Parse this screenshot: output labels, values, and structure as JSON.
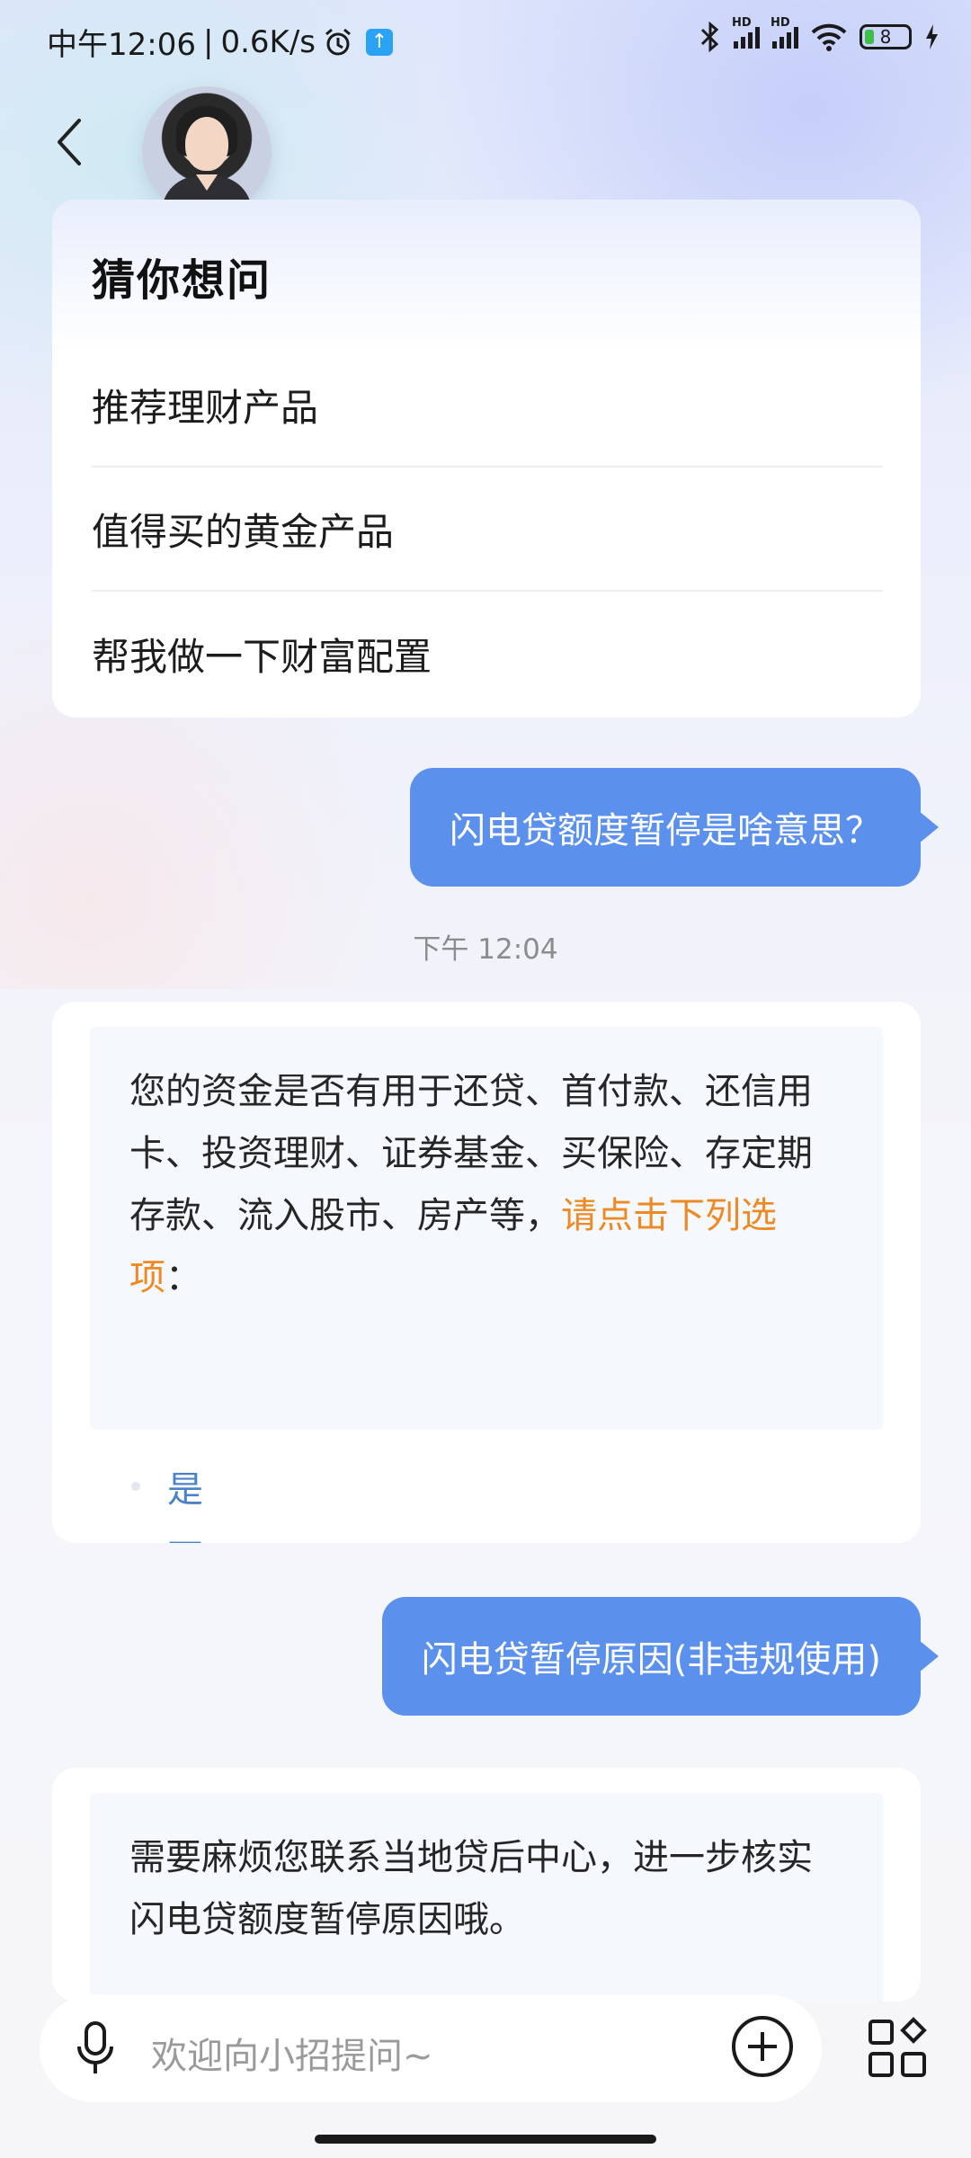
{
  "status_bar": {
    "time": "中午12:06",
    "speed": "0.6K/s",
    "battery": "8",
    "hd_label": "HD"
  },
  "guess": {
    "title": "猜你想问",
    "items": [
      {
        "label": "推荐理财产品"
      },
      {
        "label": "值得买的黄金产品"
      },
      {
        "label": "帮我做一下财富配置"
      }
    ]
  },
  "chat": {
    "user_msg_1": "闪电贷额度暂停是啥意思？",
    "timestamp_1": "下午 12:04",
    "bot_msg_1": {
      "text": "您的资金是否有用于还贷、首付款、还信用卡、投资理财、证券基金、买保险、存定期存款、流入股市、房产等，",
      "highlight": "请点击下列选项",
      "suffix": "："
    },
    "options": [
      {
        "label": "是"
      },
      {
        "label": "否"
      }
    ],
    "user_msg_2": "闪电贷暂停原因(非违规使用)",
    "bot_msg_2": "需要麻烦您联系当地贷后中心，进一步核实闪电贷额度暂停原因哦。"
  },
  "input": {
    "placeholder": "欢迎向小招提问~"
  },
  "colors": {
    "user_bubble": "#5b91ec",
    "highlight": "#ee8a24",
    "option_link": "#4a83c8"
  }
}
